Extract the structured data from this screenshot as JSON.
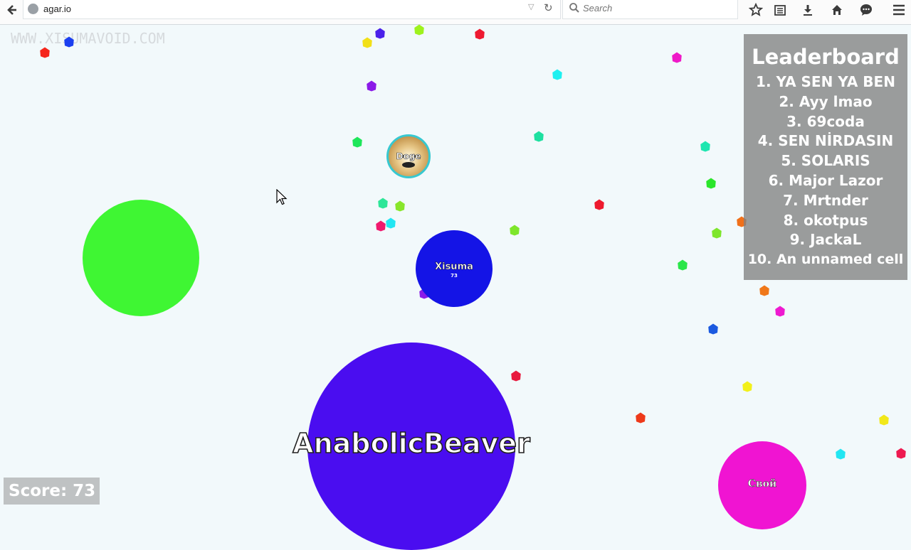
{
  "browser": {
    "url": "agar.io",
    "search_placeholder": "Search"
  },
  "watermark": "WWW.XISUMAVOID.COM",
  "leaderboard": {
    "title": "Leaderboard",
    "entries": [
      "1. YA SEN YA BEN",
      "2. Ayy lmao",
      "3. 69coda",
      "4. SEN NİRDASIN",
      "5. SOLARIS",
      "6. Major Lazor",
      "7. Mrtnder",
      "8. okotpus",
      "9. JackaL",
      "10. An unnamed cell"
    ]
  },
  "score": "Score: 73",
  "cells": {
    "player": {
      "name": "Xisuma",
      "mass": "73",
      "color": "#1414e6"
    },
    "anabolic": {
      "name": "AnabolicBeaver",
      "color": "#4a0df0"
    },
    "doge": {
      "name": "Doge"
    },
    "svoi": {
      "name": "Свой",
      "color": "#f014d2"
    }
  },
  "colors": {
    "virus": "#3ff633",
    "leaderboard_bg": "#828282",
    "background": "#f2f9fb"
  }
}
